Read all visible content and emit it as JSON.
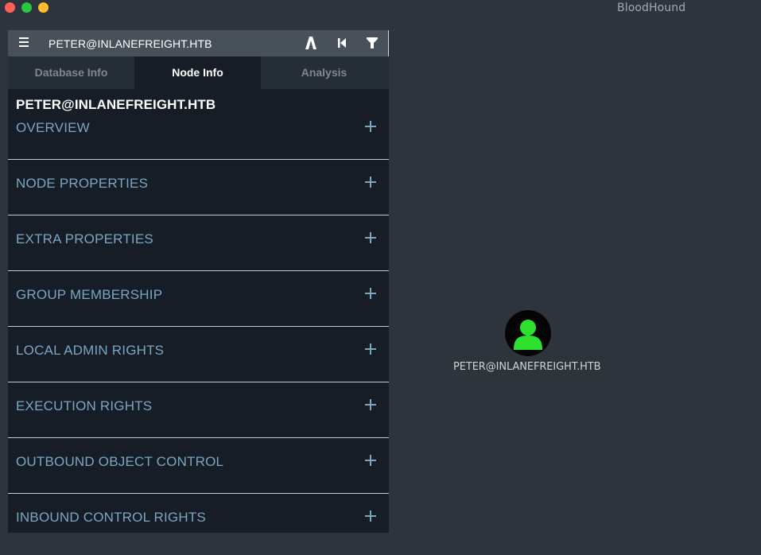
{
  "window": {
    "app_title": "BloodHound"
  },
  "searchbar": {
    "value": "PETER@INLANEFREIGHT.HTB",
    "icons": [
      "menu-icon",
      "pathfinding-icon",
      "back-icon",
      "filter-icon"
    ]
  },
  "tabs": [
    {
      "label": "Database Info",
      "active": false
    },
    {
      "label": "Node Info",
      "active": true
    },
    {
      "label": "Analysis",
      "active": false
    }
  ],
  "node_info": {
    "title": "PETER@INLANEFREIGHT.HTB",
    "sections": [
      {
        "label": "OVERVIEW"
      },
      {
        "label": "NODE PROPERTIES"
      },
      {
        "label": "EXTRA PROPERTIES"
      },
      {
        "label": "GROUP MEMBERSHIP"
      },
      {
        "label": "LOCAL ADMIN RIGHTS"
      },
      {
        "label": "EXECUTION RIGHTS"
      },
      {
        "label": "OUTBOUND OBJECT CONTROL"
      },
      {
        "label": "INBOUND CONTROL RIGHTS"
      }
    ]
  },
  "graph": {
    "node_label": "PETER@INLANEFREIGHT.HTB",
    "node_icon": "user-icon",
    "node_icon_color": "#2ee12e"
  },
  "colors": {
    "background": "#2e343c",
    "panel": "#161d26",
    "section_text": "#7aa6c2"
  }
}
